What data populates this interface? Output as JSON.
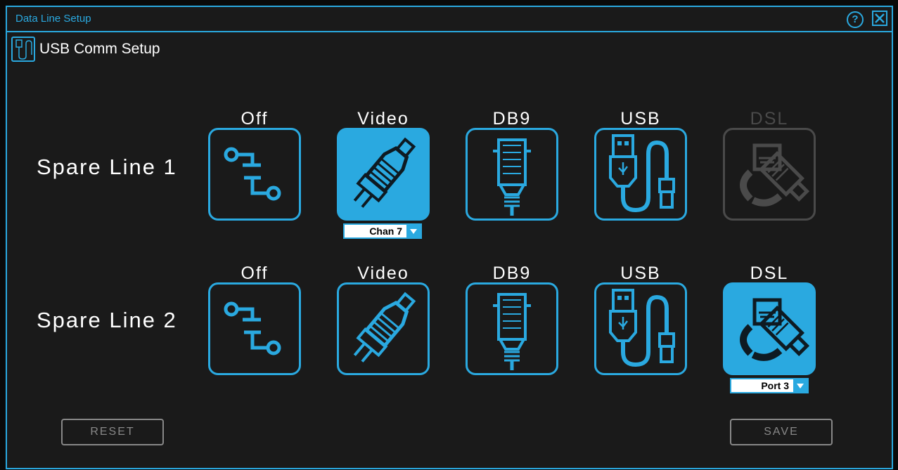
{
  "window": {
    "title": "Data Line Setup"
  },
  "header": {
    "subtitle": "USB Comm Setup"
  },
  "rows": [
    {
      "label": "Spare Line 1",
      "options": [
        {
          "label": "Off",
          "icon": "switch-icon",
          "state": "normal"
        },
        {
          "label": "Video",
          "icon": "rca-cable-icon",
          "state": "selected"
        },
        {
          "label": "DB9",
          "icon": "db9-connector-icon",
          "state": "normal"
        },
        {
          "label": "USB",
          "icon": "usb-cable-icon",
          "state": "normal"
        },
        {
          "label": "DSL",
          "icon": "ethernet-cable-icon",
          "state": "disabled"
        }
      ],
      "dropdown": {
        "value": "Chan 7"
      }
    },
    {
      "label": "Spare Line 2",
      "options": [
        {
          "label": "Off",
          "icon": "switch-icon",
          "state": "normal"
        },
        {
          "label": "Video",
          "icon": "rca-cable-icon",
          "state": "normal"
        },
        {
          "label": "DB9",
          "icon": "db9-connector-icon",
          "state": "normal"
        },
        {
          "label": "USB",
          "icon": "usb-cable-icon",
          "state": "normal"
        },
        {
          "label": "DSL",
          "icon": "ethernet-cable-icon",
          "state": "selected"
        }
      ],
      "dropdown": {
        "value": "Port 3"
      }
    }
  ],
  "buttons": {
    "reset": "RESET",
    "save": "SAVE"
  },
  "colors": {
    "accent": "#2aa9e0",
    "background": "#1a1a1a",
    "disabled": "#4a4a4a",
    "text": "#ffffff"
  }
}
